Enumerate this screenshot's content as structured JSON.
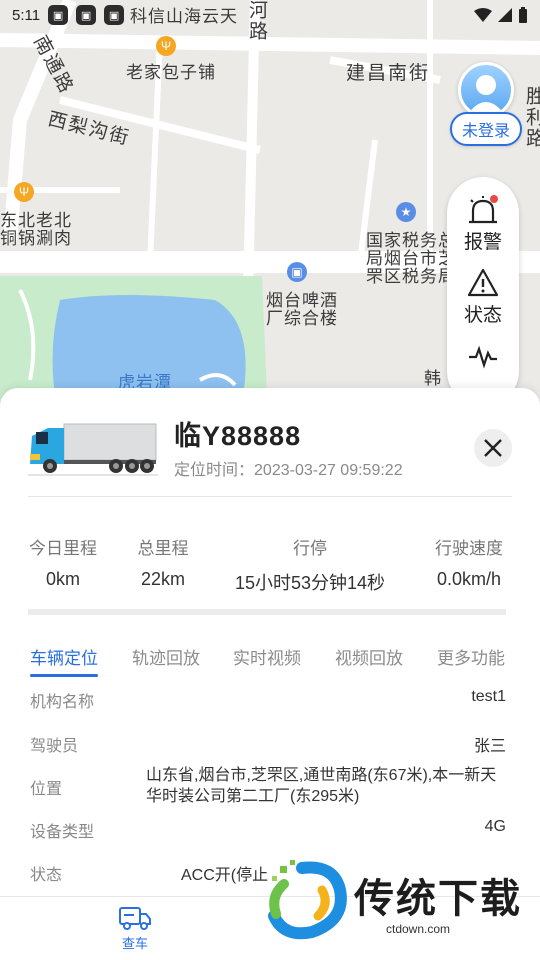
{
  "status_bar": {
    "time": "5:11"
  },
  "map": {
    "labels": {
      "kexin": "科信山海云天",
      "he": "河路",
      "nantong": "南通路",
      "laojia": "老家包子铺",
      "jianchang": "建昌南街",
      "xili": "西梨沟街",
      "shengli": "胜利路",
      "dongbei": "东北老北",
      "tongguo": "铜锅涮肉",
      "guojia": "国家税务总",
      "yantai": "局烟台市芝",
      "zhifu": "罘区税务局",
      "pijiu1": "烟台啤酒",
      "pijiu2": "厂综合楼",
      "huyantan": "虎岩潭",
      "han": "韩"
    }
  },
  "user": {
    "login_label": "未登录"
  },
  "side_panel": {
    "items": [
      {
        "label": "报警"
      },
      {
        "label": "状态"
      }
    ]
  },
  "vehicle": {
    "plate": "临Y88888",
    "loc_time_label": "定位时间：",
    "loc_time": "2023-03-27 09:59:22"
  },
  "stats": [
    {
      "label": "今日里程",
      "value": "0km"
    },
    {
      "label": "总里程",
      "value": "22km"
    },
    {
      "label": "行停",
      "value": "15小时53分钟14秒"
    },
    {
      "label": "行驶速度",
      "value": "0.0km/h"
    }
  ],
  "tabs": [
    {
      "label": "车辆定位"
    },
    {
      "label": "轨迹回放"
    },
    {
      "label": "实时视频"
    },
    {
      "label": "视频回放"
    },
    {
      "label": "更多功能"
    }
  ],
  "info": {
    "org_label": "机构名称",
    "org_value": "test1",
    "driver_label": "驾驶员",
    "driver_value": "张三",
    "position_label": "位置",
    "position_value": "山东省,烟台市,芝罘区,通世南路(东67米),本一新天华时装公司第二工厂(东295米)",
    "device_label": "设备类型",
    "device_value": "4G",
    "status_label": "状态",
    "status_value": "ACC开(停止"
  },
  "bottom_nav": {
    "label": "查车"
  },
  "watermark": {
    "text": "传统下载",
    "url": "ctdown.com"
  },
  "colors": {
    "accent": "#2a6fe0",
    "alarm_dot": "#e94a3f"
  }
}
